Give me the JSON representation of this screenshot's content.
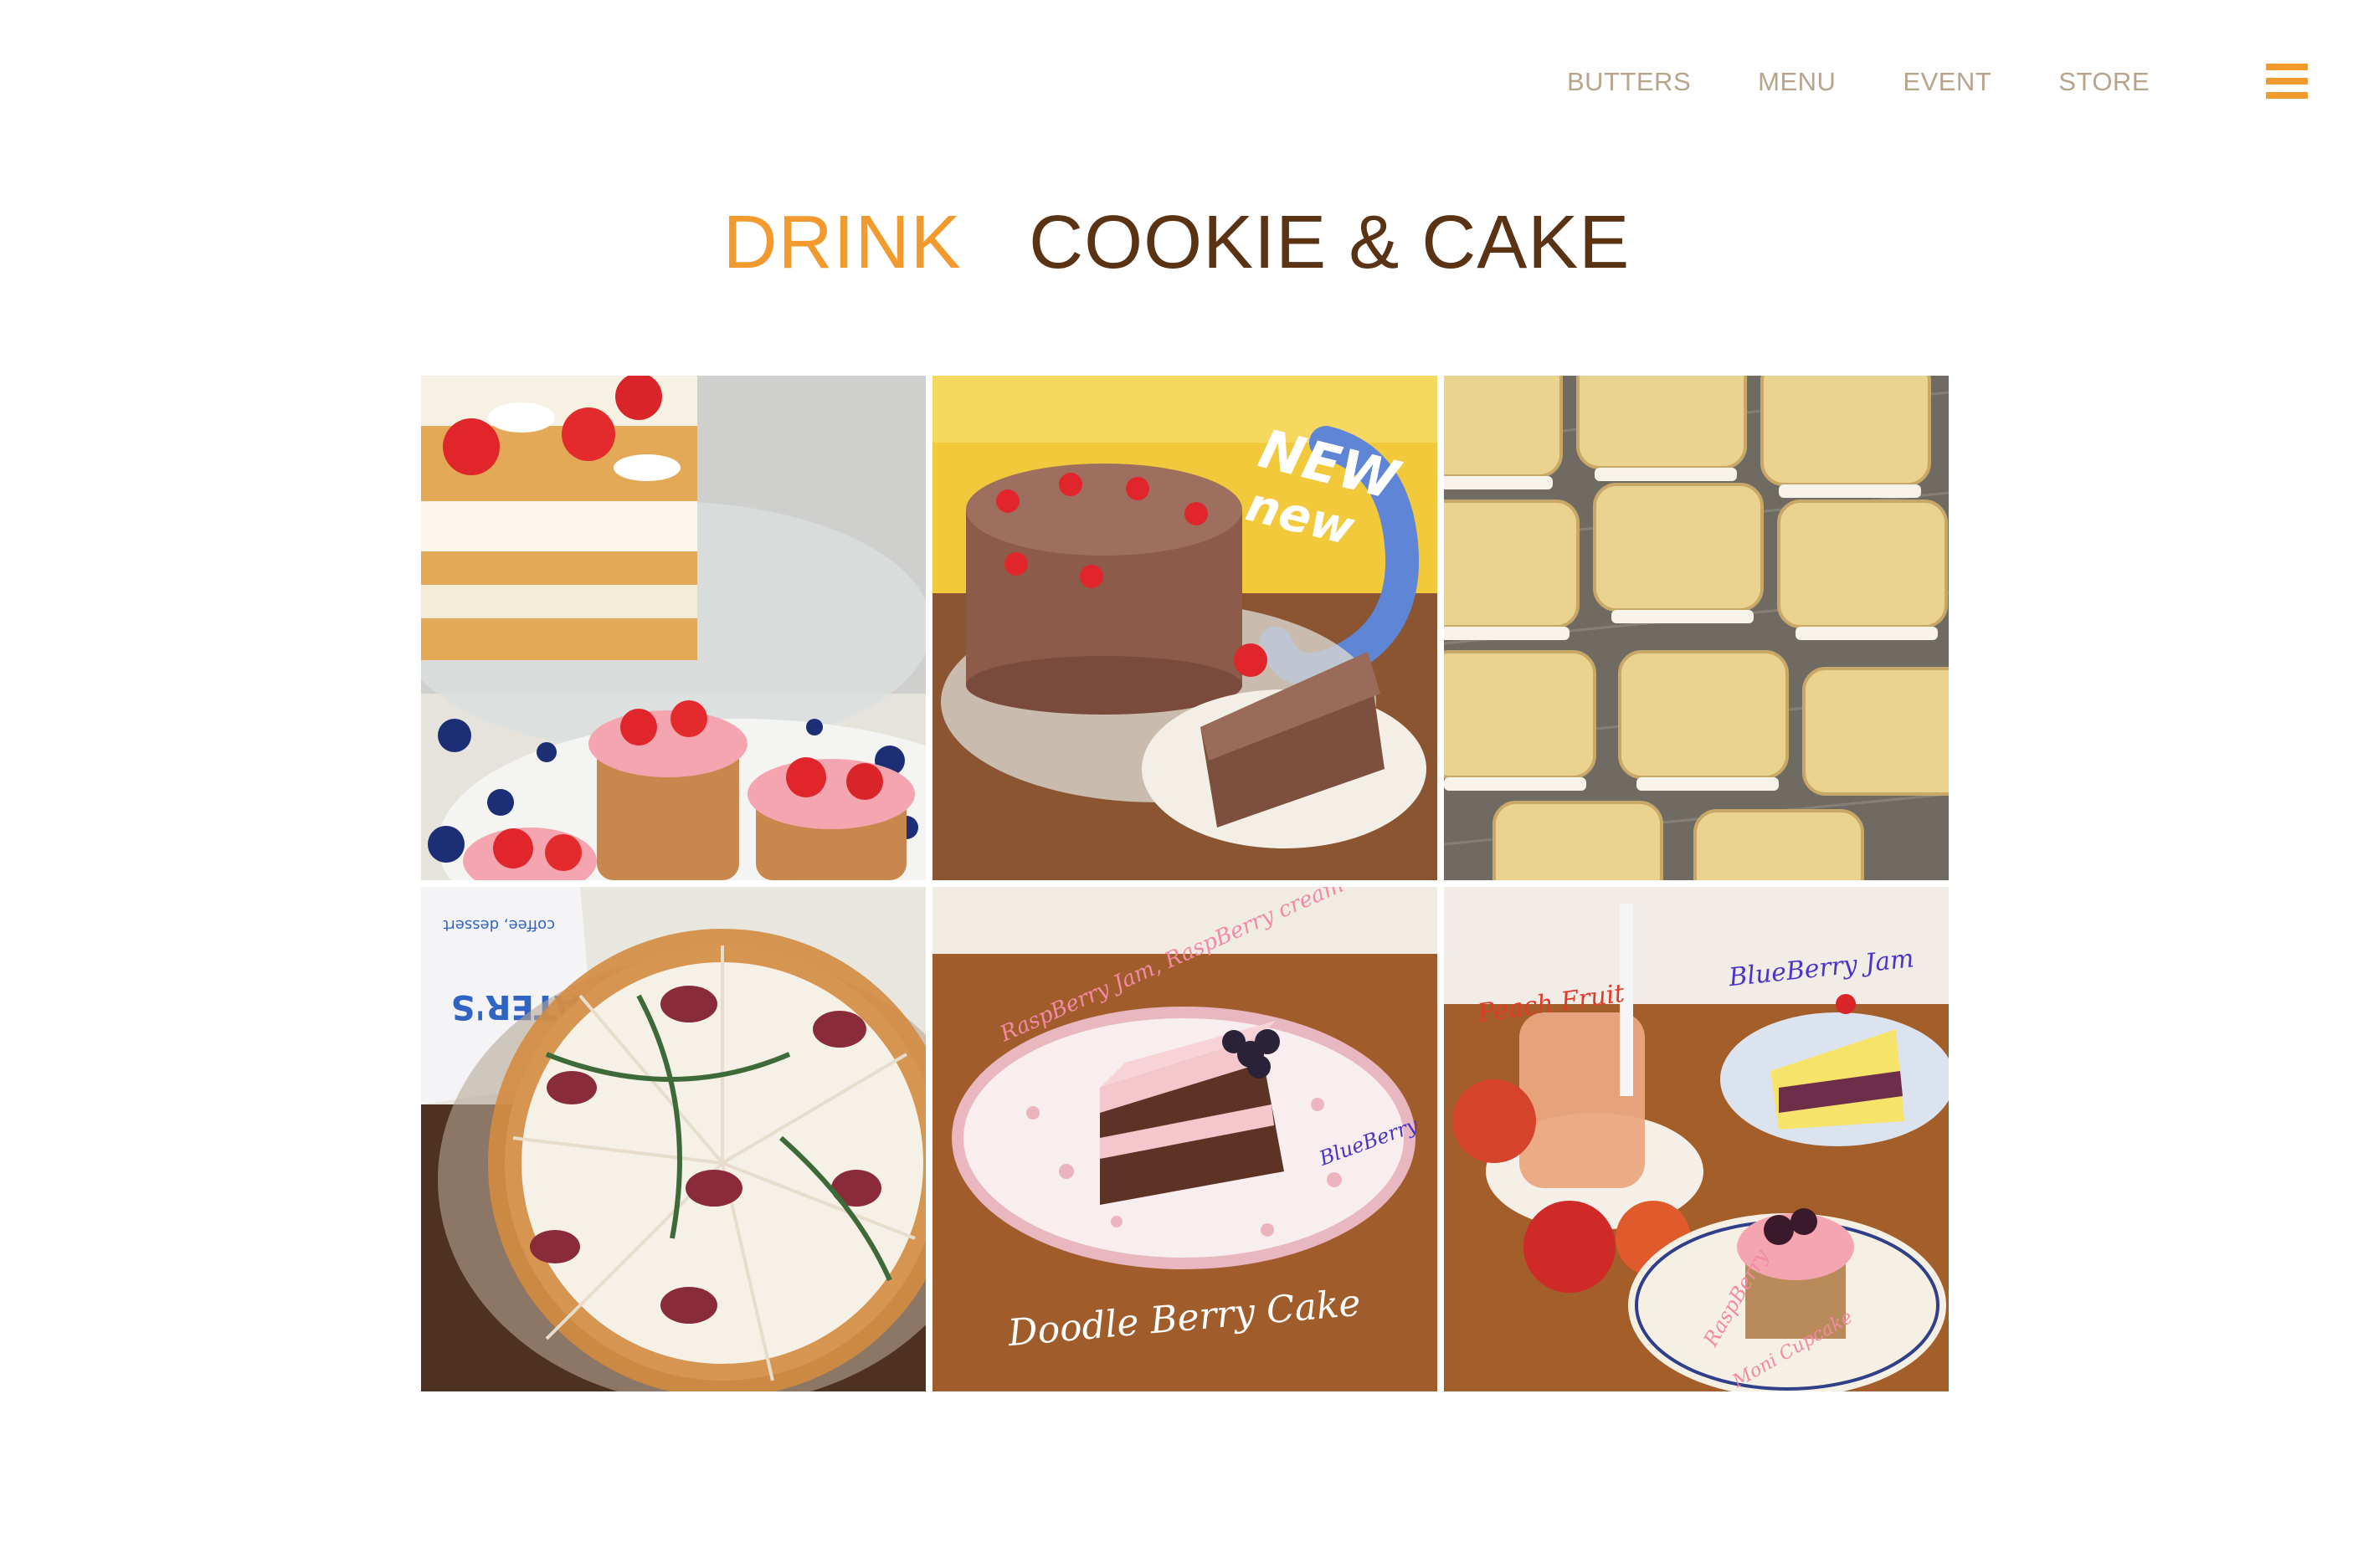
{
  "nav": {
    "items": [
      {
        "label": "BUTTERS"
      },
      {
        "label": "MENU"
      },
      {
        "label": "EVENT"
      },
      {
        "label": "STORE"
      }
    ]
  },
  "tabs": [
    {
      "label": "DRINK",
      "active": true
    },
    {
      "label": "COOKIE & CAKE",
      "active": false
    }
  ],
  "colors": {
    "accent": "#f39a2f",
    "brown": "#5a3214",
    "nav_text": "#b8a48a"
  },
  "tiles": [
    {
      "subject": "strawberry-cake"
    },
    {
      "subject": "chocolate-cherry-cake",
      "sticker_line1": "NEW",
      "sticker_line2": "new"
    },
    {
      "subject": "sandwich-cookies"
    },
    {
      "subject": "fig-cake",
      "bag_text": "ATER'S",
      "bag_sub": "coffee, dessert"
    },
    {
      "subject": "doodle-berry-cake",
      "label_main": "Doodle Berry Cake",
      "label_rasp": "RaspBerry Jam, RaspBerry cream",
      "label_blue": "BlueBerry"
    },
    {
      "subject": "peach-blueberry",
      "label_peach": "Peach Fruit",
      "label_blue": "BlueBerry Jam",
      "label_cup": "RaspBerry",
      "label_cup2": "Moni Cupcake"
    }
  ]
}
